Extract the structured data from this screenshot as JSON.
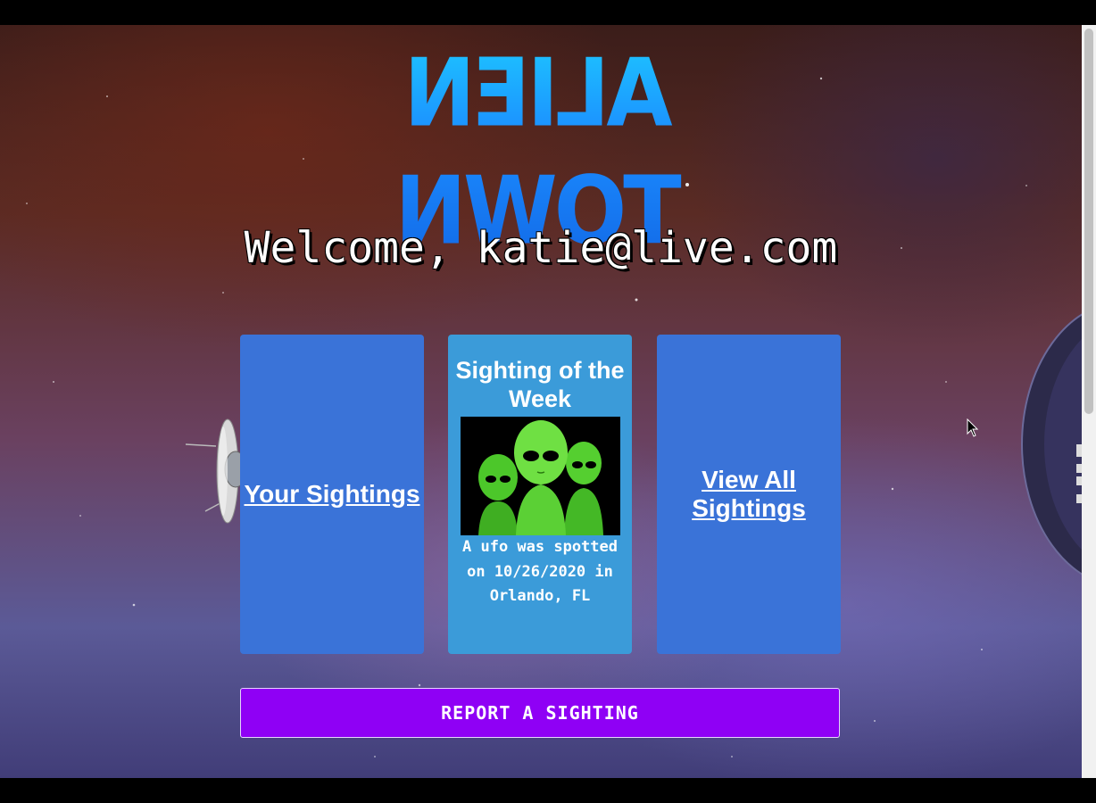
{
  "logo": {
    "text": "ALIEN TOWN"
  },
  "welcome": {
    "text": "Welcome, katie@live.com"
  },
  "cards": {
    "your_sightings": {
      "label": "Your Sightings"
    },
    "sighting_of_week": {
      "title": "Sighting of the Week",
      "caption": "A ufo was spotted on 10/26/2020 in Orlando, FL"
    },
    "view_all": {
      "label": "View All Sightings"
    }
  },
  "report_button": {
    "label": "REPORT A SIGHTING"
  },
  "colors": {
    "card_blue": "#3a73d8",
    "card_light_blue": "#3b9bd9",
    "button_purple": "#8f00f5",
    "logo_blue": "#1b8cff"
  },
  "icons": [
    "ufo-icon",
    "planet-icon",
    "alien-image",
    "mouse-cursor-icon"
  ]
}
